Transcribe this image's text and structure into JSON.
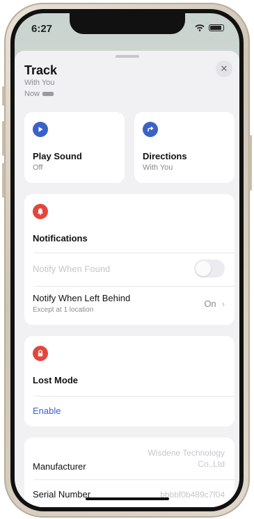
{
  "status": {
    "time": "6:27"
  },
  "sheet": {
    "title": "Track",
    "subtitle": "With You",
    "now": "Now"
  },
  "actions": {
    "play_sound": {
      "title": "Play Sound",
      "sub": "Off"
    },
    "directions": {
      "title": "Directions",
      "sub": "With You"
    }
  },
  "notifications": {
    "title": "Notifications",
    "notify_when_found": "Notify When Found",
    "notify_left_behind": "Notify When Left Behind",
    "left_behind_sub": "Except at 1 location",
    "left_behind_value": "On"
  },
  "lost_mode": {
    "title": "Lost Mode",
    "enable": "Enable"
  },
  "info": {
    "manufacturer_label": "Manufacturer",
    "manufacturer_value_line1": "Wisdene Technology",
    "manufacturer_value_line2": "Co.,Ltd",
    "serial_label": "Serial Number",
    "serial_value": "bbbbf0b489c7f04"
  },
  "colors": {
    "accent": "#3a62c8",
    "danger": "#e4463c"
  }
}
